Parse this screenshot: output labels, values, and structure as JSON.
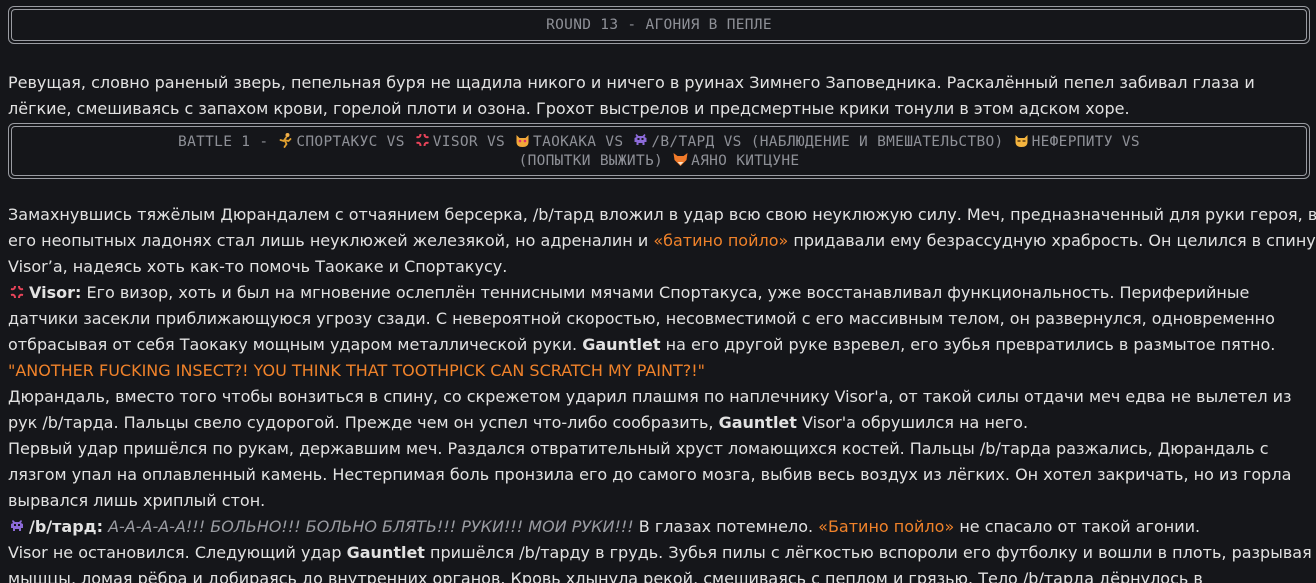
{
  "round_header": "ROUND 13 - АГОНИЯ В ПЕПЛЕ",
  "intro_lines": [
    "Ревущая, словно раненый зверь, пепельная буря не щадила никого и ничего в руинах Зимнего Заповедника. Раскалённый пепел забивал глаза и",
    "лёгкие, смешиваясь с запахом крови, горелой плоти и озона. Грохот выстрелов и предсмертные крики тонули в этом адском хоре."
  ],
  "battle_header": {
    "prefix": "BATTLE 1 - ",
    "p1": "СПОРТАКУС VS ",
    "p2": "VISOR VS ",
    "p3": "ТАОКАКА VS ",
    "p4": "/B/ТАРД VS (НАБЛЮДЕНИЕ И ВМЕШАТЕЛЬСТВО) ",
    "p5": "НЕФЕРПИТУ VS",
    "line2_prefix": "(ПОПЫТКИ ВЫЖИТЬ) ",
    "p6": "АЯНО КИТЦУНЕ"
  },
  "story": {
    "l1": "Замахнувшись тяжёлым Дюрандалем с отчаянием берсерка, /b/тард вложил в удар всю свою неуклюжую силу. Меч, предназначенный для руки героя, в",
    "l2a": "его неопытных ладонях стал лишь неуклюжей железякой, но адреналин и ",
    "l2b": "«батино пойло»",
    "l2c": " придавали ему безрассудную храбрость. Он целился в спину",
    "l3": "Visor’а, надеясь хоть как-то помочь Таокаке и Спортакусу.",
    "l4_name": "Visor:",
    "l4": " Его визор, хоть и был на мгновение ослеплён теннисными мячами Спортакуса, уже восстанавливал функциональность. Периферийные",
    "l5": "датчики засекли приближающуюся угрозу сзади. С невероятной скоростью, несовместимой с его массивным телом, он развернулся, одновременно",
    "l6a": "отбрасывая от себя Таокаку мощным ударом металлической руки. ",
    "l6b": "Gauntlet",
    "l6c": " на его другой руке взревел, его зубья превратились в размытое пятно.",
    "l7": "\"ANOTHER FUCKING INSECT?! YOU THINK THAT TOOTHPICK CAN SCRATCH MY PAINT?!\"",
    "l8": "Дюрандаль, вместо того чтобы вонзиться в спину, со скрежетом ударил плашмя по наплечнику Visor'а, от такой силы отдачи меч едва не вылетел из",
    "l9a": "рук /b/тарда. Пальцы свело судорогой. Прежде чем он успел что-либо сообразить, ",
    "l9b": "Gauntlet",
    "l9c": " Visor'а обрушился на него.",
    "l10": "Первый удар пришёлся по рукам, державшим меч. Раздался отвратительный хруст ломающихся костей. Пальцы /b/тарда разжались, Дюрандаль с",
    "l11": "лязгом упал на оплавленный камень. Нестерпимая боль пронзила его до самого мозга, выбив весь воздух из лёгких. Он хотел закричать, но из горла",
    "l12": "вырвался лишь хриплый стон.",
    "l13_name": "/b/тард:",
    "l13_cry": " А-А-А-А-А!!! БОЛЬНО!!! БОЛЬНО БЛЯТЬ!!! РУКИ!!! МОИ РУКИ!!!",
    "l13b": " В глазах потемнело. ",
    "l13c": "«Батино пойло»",
    "l13d": " не спасало от такой агонии.",
    "l14a": "Visor не остановился. Следующий удар ",
    "l14b": "Gauntlet",
    "l14c": " пришёлся /b/тарду в грудь. Зубья пилы с лёгкостью вспороли его футболку и вошли в плоть, разрывая",
    "l15": "мышцы, ломая рёбра и добираясь до внутренних органов. Кровь хлынула рекой, смешиваясь с пеплом и грязью. Тело /b/тарда дёрнулось в"
  },
  "colors": {
    "background": "#15161a",
    "text": "#e2e2e2",
    "header_text": "#8e9097",
    "accent_orange": "#f0822a",
    "muted_italic": "#9a9ca2"
  },
  "icons": {
    "sportacus": "runner-icon",
    "visor": "anger-icon",
    "taokaka": "cat-face-icon",
    "btard": "alien-monster-icon",
    "neferpitou": "cat-icon",
    "ayano": "fox-icon"
  }
}
